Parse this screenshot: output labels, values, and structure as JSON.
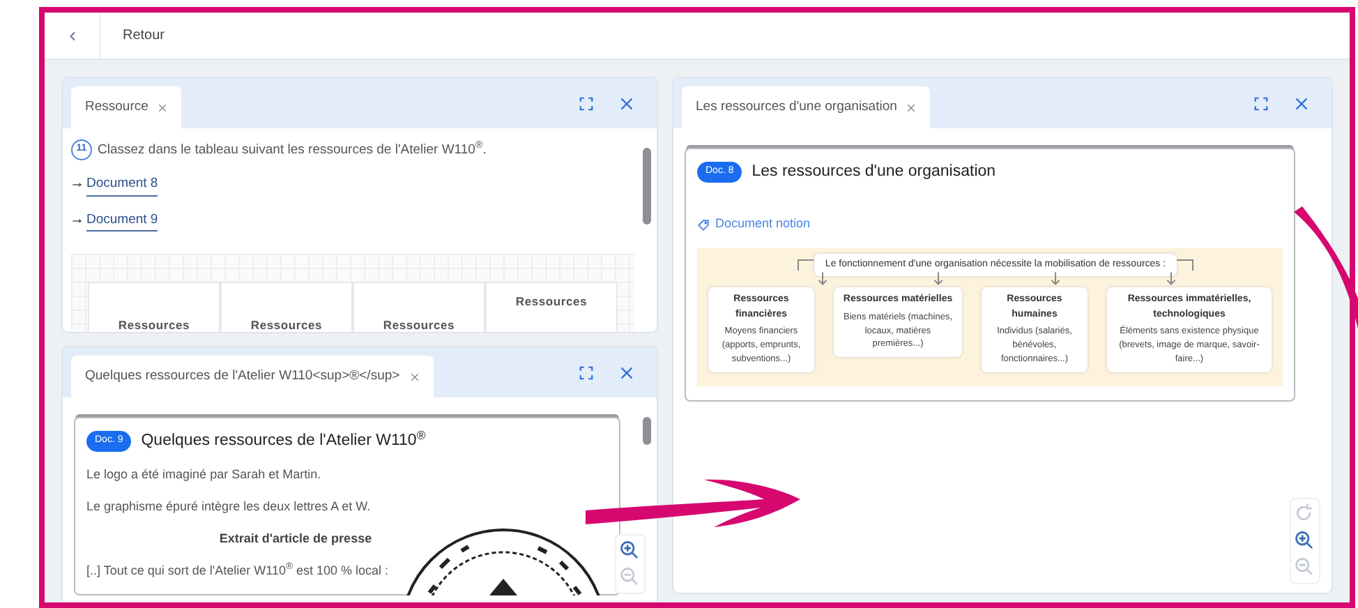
{
  "header": {
    "title": "Retour"
  },
  "panels": [
    {
      "kind": "question",
      "tabs": [
        {
          "label": "Ressource",
          "selected": true
        }
      ],
      "question": {
        "number": "11",
        "text": "Classez dans le tableau suivant les ressources de l'Atelier W110$^{®}$."
      },
      "links": [
        "Document 8",
        "Document 9"
      ],
      "table": {
        "columns": [
          "Ressources",
          "Ressources",
          "Ressources",
          "Ressources"
        ]
      }
    },
    {
      "kind": "document",
      "tabs": [
        {
          "label": "Quelques ressources de l'Atelier W110<sup>®</sup>",
          "selected": true
        }
      ],
      "doc": {
        "badge": "Doc. 9",
        "title": "Quelques ressources de l'Atelier W110$^{®}$",
        "blocks": [
          {
            "kind": "text",
            "text": "Le logo a été imaginé par Sarah et Martin."
          },
          {
            "kind": "text",
            "text": "Le graphisme épuré intègre les deux lettres A et W."
          },
          {
            "kind": "heading",
            "text": "Extrait d'article de presse"
          },
          {
            "kind": "text",
            "text": "[..] Tout ce qui sort de l'Atelier W110$^{®}$ est 100 % local :"
          },
          {
            "kind": "stamp"
          }
        ]
      },
      "zoom_controls": [
        {
          "kind": "zoom_in",
          "disabled": false
        },
        {
          "kind": "zoom_out",
          "disabled": true
        }
      ]
    },
    {
      "kind": "document",
      "tabs": [
        {
          "label": "Les ressources d'une organisation",
          "selected": true
        }
      ],
      "doc": {
        "badge": "Doc. 8",
        "title": "Les ressources d'une organisation",
        "blocks": [
          {
            "kind": "notion_link",
            "text": "Document notion"
          },
          {
            "kind": "diagram",
            "heading": "Le fonctionnement d'une organisation nécessite la mobilisation de ressources :",
            "boxes": [
              {
                "title": "Ressources financières",
                "description": "Moyens financiers (apports, emprunts, subventions...)"
              },
              {
                "title": "Ressources matérielles",
                "description": "Biens matériels (machines, locaux, matières premières...)"
              },
              {
                "title": "Ressources humaines",
                "description": "Individus (salariés, bénévoles, fonctionnaires...)"
              },
              {
                "title": "Ressources immatérielles, technologiques",
                "description": "Éléments sans existence physique (brevets, image de marque, savoir-faire...)"
              }
            ]
          }
        ]
      },
      "zoom_controls": [
        {
          "kind": "rotate",
          "disabled": true
        },
        {
          "kind": "zoom_in",
          "disabled": false
        },
        {
          "kind": "zoom_out",
          "disabled": true
        }
      ]
    }
  ]
}
